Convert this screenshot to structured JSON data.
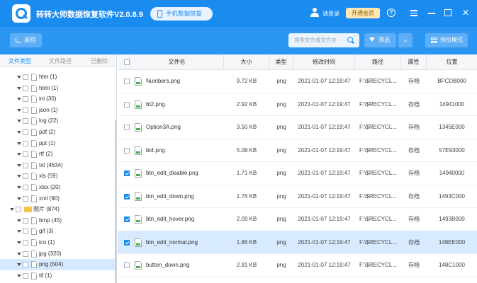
{
  "app": {
    "title": "转转大师数据恢复软件V2.0.8.9",
    "phone_label": "手机数据恢复",
    "login": "请登录",
    "vip": "开通会员"
  },
  "toolbar": {
    "back": "返回",
    "search_placeholder": "搜索文件或文件夹",
    "filter": "筛选",
    "preview": "预览模式"
  },
  "left_tabs": [
    "文件类型",
    "文件路径",
    "已删除"
  ],
  "tree": [
    {
      "label": "htm (1)"
    },
    {
      "label": "html (1)"
    },
    {
      "label": "ini (30)"
    },
    {
      "label": "json (1)"
    },
    {
      "label": "log (22)"
    },
    {
      "label": "pdf (2)"
    },
    {
      "label": "ppt (1)"
    },
    {
      "label": "rtf (2)"
    },
    {
      "label": "txt (4634)"
    },
    {
      "label": "xls (59)"
    },
    {
      "label": "xlsx (20)"
    },
    {
      "label": "xml (90)"
    },
    {
      "label": "图片 (874)"
    },
    {
      "label": "bmp (45)"
    },
    {
      "label": "gif (3)"
    },
    {
      "label": "ico (1)"
    },
    {
      "label": "jpg (320)"
    },
    {
      "label": "png (504)"
    },
    {
      "label": "tif (1)"
    }
  ],
  "columns": [
    "文件名",
    "大小",
    "类型",
    "修改时间",
    "路径",
    "属性",
    "位置"
  ],
  "rows": [
    {
      "name": "Numbers.png",
      "size": "9.72 KB",
      "type": "png",
      "time": "2021-01-07 12:19:47",
      "path": "F:\\$RECYCL...",
      "attr": "存档",
      "pos": "BFCDB000",
      "checked": false
    },
    {
      "name": "bt2.png",
      "size": "2.92 KB",
      "type": "png",
      "time": "2021-01-07 12:19:47",
      "path": "F:\\$RECYCL...",
      "attr": "存档",
      "pos": "14941000",
      "checked": false
    },
    {
      "name": "Option3A.png",
      "size": "3.50 KB",
      "type": "png",
      "time": "2021-01-07 12:19:47",
      "path": "F:\\$RECYCL...",
      "attr": "存档",
      "pos": "1345E000",
      "checked": false
    },
    {
      "name": "bt4.png",
      "size": "5.08 KB",
      "type": "png",
      "time": "2021-01-07 12:19:47",
      "path": "F:\\$RECYCL...",
      "attr": "存档",
      "pos": "57E93000",
      "checked": false
    },
    {
      "name": "btn_edit_disable.png",
      "size": "1.71 KB",
      "type": "png",
      "time": "2021-01-07 12:19:47",
      "path": "F:\\$RECYCL...",
      "attr": "存档",
      "pos": "14940000",
      "checked": true
    },
    {
      "name": "btn_edit_down.png",
      "size": "1.76 KB",
      "type": "png",
      "time": "2021-01-07 12:19:47",
      "path": "F:\\$RECYCL...",
      "attr": "存档",
      "pos": "1493C000",
      "checked": true
    },
    {
      "name": "btn_edit_hover.png",
      "size": "2.09 KB",
      "type": "png",
      "time": "2021-01-07 12:19:47",
      "path": "F:\\$RECYCL...",
      "attr": "存档",
      "pos": "1493B000",
      "checked": true
    },
    {
      "name": "btn_edit_normal.png",
      "size": "1.86 KB",
      "type": "png",
      "time": "2021-01-07 12:19:47",
      "path": "F:\\$RECYCL...",
      "attr": "存档",
      "pos": "148EE000",
      "checked": true
    },
    {
      "name": "button_down.png",
      "size": "2.91 KB",
      "type": "png",
      "time": "2021-01-07 12:19:47",
      "path": "F:\\$RECYCL...",
      "attr": "存档",
      "pos": "148C1000",
      "checked": false
    }
  ]
}
